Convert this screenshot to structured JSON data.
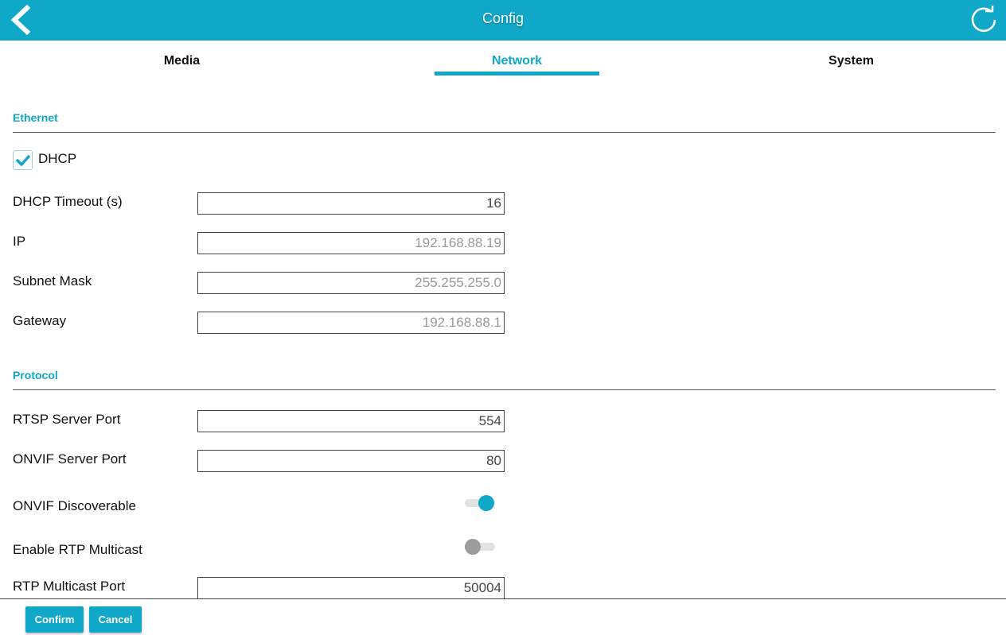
{
  "header": {
    "title": "Config",
    "back_icon": "chevron-left-icon",
    "refresh_icon": "refresh-icon",
    "background_color": "#10a8c8"
  },
  "tabs": [
    {
      "label": "Media",
      "active": false
    },
    {
      "label": "Network",
      "active": true
    },
    {
      "label": "System",
      "active": false
    }
  ],
  "ethernet": {
    "section_title": "Ethernet",
    "dhcp": {
      "label": "DHCP",
      "checked": true
    },
    "dhcp_timeout": {
      "label": "DHCP Timeout (s)",
      "value": "16"
    },
    "ip": {
      "label": "IP",
      "value": "192.168.88.19"
    },
    "subnet_mask": {
      "label": "Subnet Mask",
      "value": "255.255.255.0"
    },
    "gateway": {
      "label": "Gateway",
      "value": "192.168.88.1"
    }
  },
  "protocol": {
    "section_title": "Protocol",
    "rtsp_port": {
      "label": "RTSP Server Port",
      "value": "554"
    },
    "onvif_port": {
      "label": "ONVIF Server Port",
      "value": "80"
    },
    "onvif_discoverable": {
      "label": "ONVIF Discoverable",
      "on": true
    },
    "rtp_multicast": {
      "label": "Enable RTP Multicast",
      "on": false
    },
    "rtp_multicast_port": {
      "label": "RTP Multicast Port",
      "value": "50004"
    }
  },
  "footer": {
    "confirm_label": "Confirm",
    "cancel_label": "Cancel"
  },
  "colors": {
    "accent": "#10a8c8",
    "toggle_off": "#9b9b9b"
  }
}
